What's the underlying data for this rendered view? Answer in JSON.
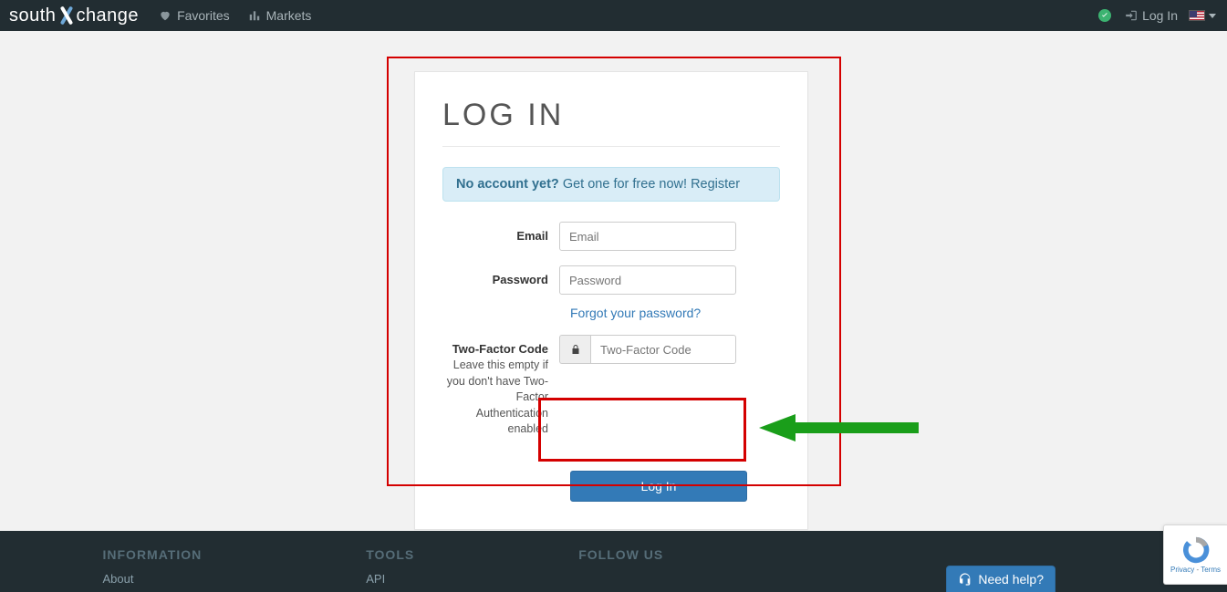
{
  "brand": {
    "part1": "south",
    "part2": "change"
  },
  "nav": {
    "favorites": "Favorites",
    "markets": "Markets",
    "login": "Log In"
  },
  "login": {
    "title": "LOG IN",
    "alert_bold": "No account yet?",
    "alert_text": " Get one for free now! ",
    "alert_link": "Register",
    "email_label": "Email",
    "email_placeholder": "Email",
    "password_label": "Password",
    "password_placeholder": "Password",
    "forgot": "Forgot your password?",
    "twofa_label": "Two-Factor Code",
    "twofa_help": "Leave this empty if you don't have Two-Factor Authentication enabled",
    "twofa_placeholder": "Two-Factor Code",
    "submit": "Log In"
  },
  "footer": {
    "col1_title": "INFORMATION",
    "col1_link1": "About",
    "col2_title": "TOOLS",
    "col2_link1": "API",
    "col3_title": "FOLLOW US"
  },
  "help_button": "Need help?",
  "recaptcha": {
    "privacy": "Privacy",
    "terms": "Terms",
    "sep": " - "
  }
}
